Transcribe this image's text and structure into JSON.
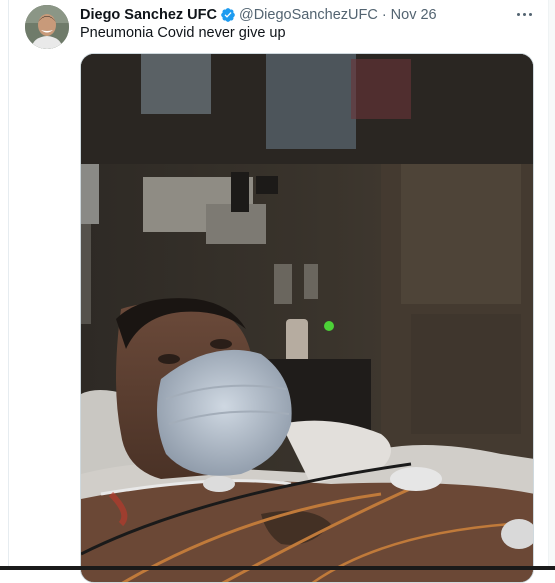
{
  "tweet": {
    "display_name": "Diego Sanchez UFC",
    "handle": "@DiegoSanchezUFC",
    "separator": "·",
    "date": "Nov 26",
    "text": "Pneumonia Covid never give up",
    "verified": true,
    "verified_color": "#1d9bf0",
    "more_icon": "more-horizontal-icon"
  },
  "colors": {
    "text_primary": "#0f1419",
    "text_secondary": "#536471",
    "border": "#cfd9de"
  }
}
